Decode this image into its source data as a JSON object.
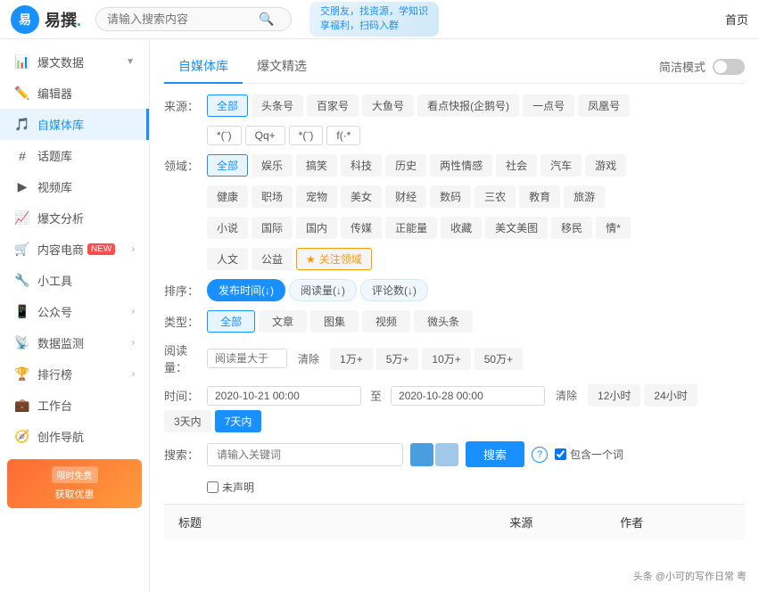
{
  "header": {
    "logo_text": "易撰",
    "logo_dot": ".",
    "search_placeholder": "请输入搜索内容",
    "banner_line1": "交朋友，找资源，学知识",
    "banner_line2": "享福利，扫码入群",
    "nav_home": "首页"
  },
  "sidebar": {
    "items": [
      {
        "id": "baowen",
        "label": "爆文数据",
        "icon": "📊",
        "has_arrow": true
      },
      {
        "id": "editor",
        "label": "编辑器",
        "icon": "✏️",
        "has_arrow": false
      },
      {
        "id": "zimeiti",
        "label": "自媒体库",
        "icon": "🎵",
        "active": true,
        "has_arrow": false
      },
      {
        "id": "topic",
        "label": "话题库",
        "icon": "#",
        "has_arrow": false
      },
      {
        "id": "video",
        "label": "视频库",
        "icon": "▶",
        "has_arrow": false
      },
      {
        "id": "analysis",
        "label": "爆文分析",
        "icon": "📈",
        "has_arrow": false
      },
      {
        "id": "ecommerce",
        "label": "内容电商",
        "icon": "🛒",
        "badge": "NEW",
        "has_arrow": true
      },
      {
        "id": "tools",
        "label": "小工具",
        "icon": "🔧",
        "has_arrow": false
      },
      {
        "id": "public",
        "label": "公众号",
        "icon": "📱",
        "has_arrow": true
      },
      {
        "id": "monitor",
        "label": "数据监测",
        "icon": "📡",
        "has_arrow": true
      },
      {
        "id": "ranking",
        "label": "排行榜",
        "icon": "🏆",
        "has_arrow": true
      },
      {
        "id": "workspace",
        "label": "工作台",
        "icon": "💼",
        "has_arrow": false
      },
      {
        "id": "guide",
        "label": "创作导航",
        "icon": "🧭",
        "has_arrow": false
      }
    ],
    "promo": {
      "badge": "限时免费",
      "text": "获取优惠"
    }
  },
  "content": {
    "tabs": [
      {
        "id": "zimeiti",
        "label": "自媒体库",
        "active": true
      },
      {
        "id": "baowen",
        "label": "爆文精选"
      },
      {
        "id": "simple",
        "label": "简洁模式"
      }
    ],
    "filters": {
      "source_label": "来源：",
      "sources": [
        {
          "label": "全部",
          "active": true
        },
        {
          "label": "头条号"
        },
        {
          "label": "百家号"
        },
        {
          "label": "大鱼号"
        },
        {
          "label": "看点快报(企鹅号)"
        },
        {
          "label": "一点号"
        },
        {
          "label": "凤凰号"
        }
      ],
      "sources_row2": [
        {
          "label": "*(¨)"
        },
        {
          "label": "Qq+"
        },
        {
          "label": "*(¨)"
        },
        {
          "label": "f(·*"
        }
      ],
      "domain_label": "领域：",
      "domains": [
        {
          "label": "全部",
          "active": true
        },
        {
          "label": "娱乐"
        },
        {
          "label": "搞笑"
        },
        {
          "label": "科技"
        },
        {
          "label": "历史"
        },
        {
          "label": "两性情感"
        },
        {
          "label": "社会"
        },
        {
          "label": "汽车"
        },
        {
          "label": "游戏"
        }
      ],
      "domains_row2": [
        {
          "label": "健康"
        },
        {
          "label": "职场"
        },
        {
          "label": "宠物"
        },
        {
          "label": "美女"
        },
        {
          "label": "财经"
        },
        {
          "label": "数码"
        },
        {
          "label": "三农"
        },
        {
          "label": "教育"
        },
        {
          "label": "旅游"
        }
      ],
      "domains_row3": [
        {
          "label": "小说"
        },
        {
          "label": "国际"
        },
        {
          "label": "国内"
        },
        {
          "label": "传媒"
        },
        {
          "label": "正能量"
        },
        {
          "label": "收藏"
        },
        {
          "label": "美文美图"
        },
        {
          "label": "移民"
        },
        {
          "label": "情*"
        }
      ],
      "domains_row4_special1": "人文",
      "domains_row4_special2": "公益",
      "domains_star": "★关注领域",
      "sort_label": "排序：",
      "sorts": [
        {
          "label": "发布时间(↓)",
          "active": true
        },
        {
          "label": "阅读量(↓)"
        },
        {
          "label": "评论数(↓)"
        }
      ],
      "type_label": "类型：",
      "types": [
        {
          "label": "全部",
          "active": true
        },
        {
          "label": "文章"
        },
        {
          "label": "图集"
        },
        {
          "label": "视频"
        },
        {
          "label": "微头条"
        }
      ],
      "read_label": "阅读量：",
      "read_placeholder": "阅读量大于",
      "read_clear": "清除",
      "read_options": [
        {
          "label": "1万+"
        },
        {
          "label": "5万+"
        },
        {
          "label": "10万+"
        },
        {
          "label": "50万+"
        }
      ],
      "time_label": "时间：",
      "time_start": "2020-10-21 00:00",
      "time_sep": "至",
      "time_end": "2020-10-28 00:00",
      "time_clear": "清除",
      "time_options": [
        {
          "label": "12小时"
        },
        {
          "label": "24小时"
        },
        {
          "label": "3天内"
        },
        {
          "label": "7天内",
          "active": true
        }
      ],
      "search_label": "搜索：",
      "search_keyword_placeholder": "请输入关键词",
      "search_btn": "搜索",
      "help_icon": "?",
      "include_label": "包含一个词",
      "not_stated_label": "未声明"
    },
    "table": {
      "columns": [
        {
          "label": "标题"
        },
        {
          "label": "来源"
        },
        {
          "label": "作者"
        }
      ]
    }
  },
  "watermark": "头条 @小可的写作日常 粤"
}
